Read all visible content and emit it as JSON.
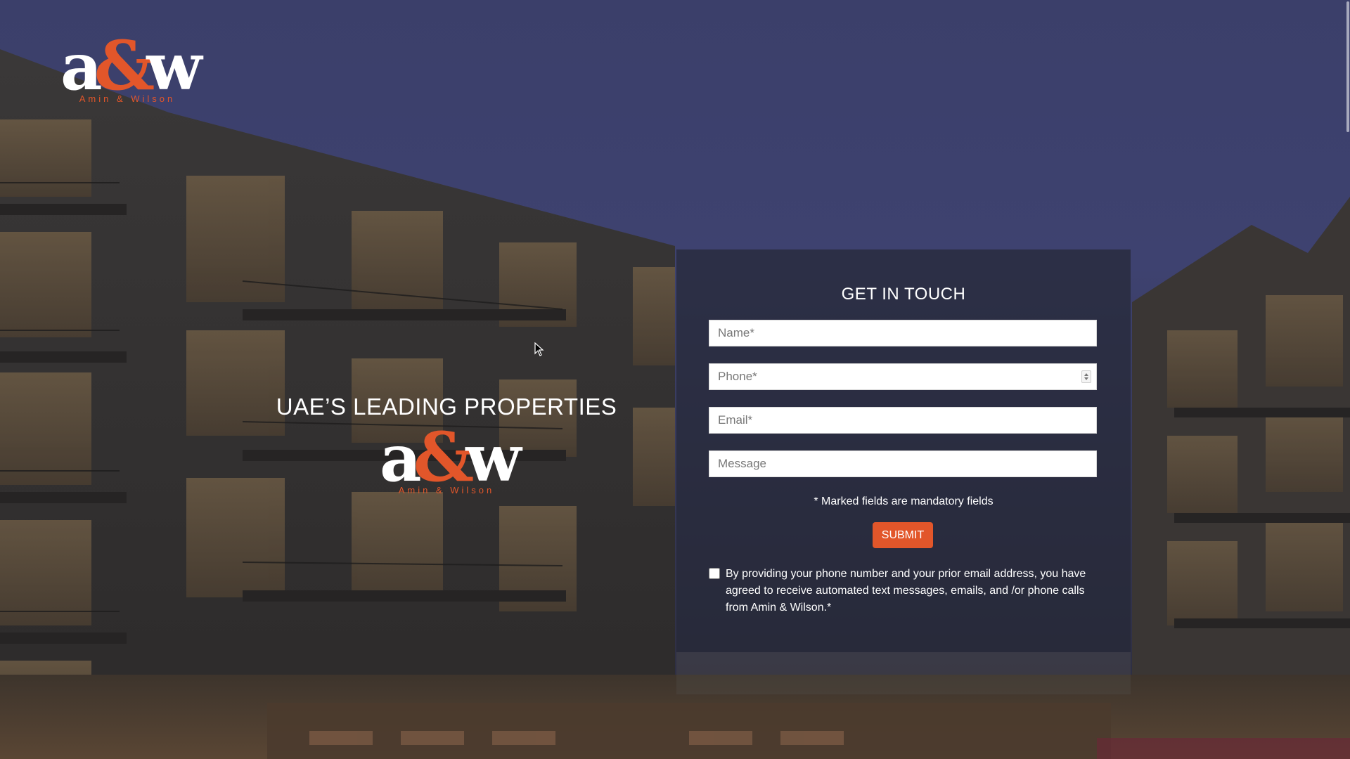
{
  "brand": {
    "logo_letter_a": "a",
    "logo_amp": "&",
    "logo_letter_w": "w",
    "logo_subtitle": "Amin & Wilson",
    "accent_color": "#e2562a"
  },
  "hero": {
    "title": "UAE’S LEADING PROPERTIES"
  },
  "form": {
    "title": "GET IN TOUCH",
    "name_placeholder": "Name*",
    "phone_placeholder": "Phone*",
    "email_placeholder": "Email*",
    "message_placeholder": "Message",
    "mandatory_note": "* Marked fields are mandatory fields",
    "submit_label": "SUBMIT",
    "consent_text": "By providing your phone number and your prior email address, you have agreed to receive automated text messages, emails, and /or phone calls from Amin & Wilson.*",
    "consent_checked": false
  },
  "icons": {
    "spinner": "number-spinner-icon",
    "cursor": "mouse-cursor-icon"
  }
}
